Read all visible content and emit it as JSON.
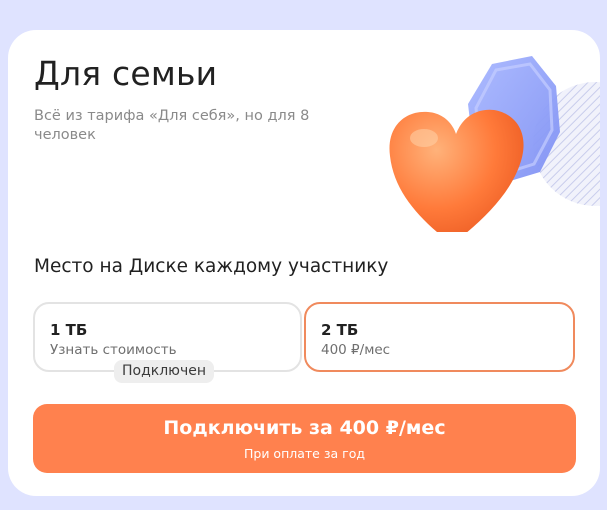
{
  "plan": {
    "title": "Для семьи",
    "subtitle": "Всё из тарифа «Для себя»,  но для 8 человек"
  },
  "storage": {
    "section_title": "Место на Диске каждому участнику",
    "options": [
      {
        "size": "1 ТБ",
        "price_text": "Узнать стоимость",
        "badge": "Подключен",
        "selected": false
      },
      {
        "size": "2 ТБ",
        "price_text": "400 ₽/мес",
        "selected": true
      }
    ]
  },
  "cta": {
    "label": "Подключить за 400 ₽/мес",
    "note": "При оплате за год"
  },
  "colors": {
    "accent": "#ff814e",
    "selected_border": "#f08a5d",
    "page_bg": "#dfe3ff"
  },
  "icons": [
    "heart-illustration",
    "octagon-illustration",
    "striped-circle-illustration"
  ]
}
